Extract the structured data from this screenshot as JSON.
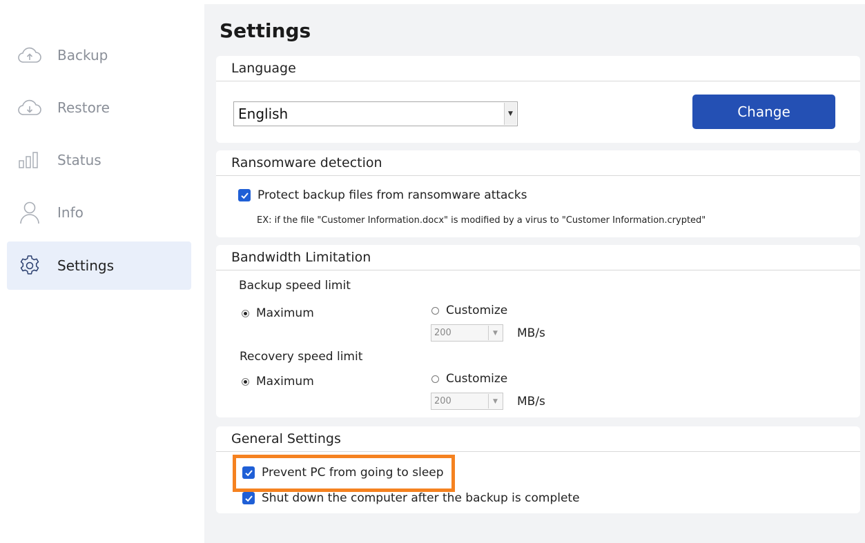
{
  "sidebar": {
    "items": [
      {
        "label": "Backup",
        "icon": "cloud-upload-icon"
      },
      {
        "label": "Restore",
        "icon": "cloud-download-icon"
      },
      {
        "label": "Status",
        "icon": "bar-chart-icon"
      },
      {
        "label": "Info",
        "icon": "user-icon"
      },
      {
        "label": "Settings",
        "icon": "gear-icon",
        "active": true
      }
    ]
  },
  "page": {
    "title": "Settings"
  },
  "language": {
    "header": "Language",
    "selected": "English",
    "change_label": "Change"
  },
  "ransomware": {
    "header": "Ransomware detection",
    "protect_label": "Protect backup files from ransomware attacks",
    "protect_checked": true,
    "example": "EX: if the file \"Customer Information.docx\" is modified by a virus to \"Customer Information.crypted\""
  },
  "bandwidth": {
    "header": "Bandwidth Limitation",
    "backup": {
      "label": "Backup speed limit",
      "maximum_label": "Maximum",
      "customize_label": "Customize",
      "value": "200",
      "unit": "MB/s",
      "selected": "Maximum"
    },
    "recovery": {
      "label": "Recovery speed limit",
      "maximum_label": "Maximum",
      "customize_label": "Customize",
      "value": "200",
      "unit": "MB/s",
      "selected": "Maximum"
    }
  },
  "general": {
    "header": "General Settings",
    "prevent_sleep_label": "Prevent PC from going to sleep",
    "prevent_sleep_checked": true,
    "shutdown_label": "Shut down the computer after the backup is complete",
    "shutdown_checked": true
  },
  "colors": {
    "accent": "#2450b4",
    "checkbox": "#1f5fd6",
    "highlight": "#f58220",
    "active_nav_bg": "#e9effa"
  }
}
